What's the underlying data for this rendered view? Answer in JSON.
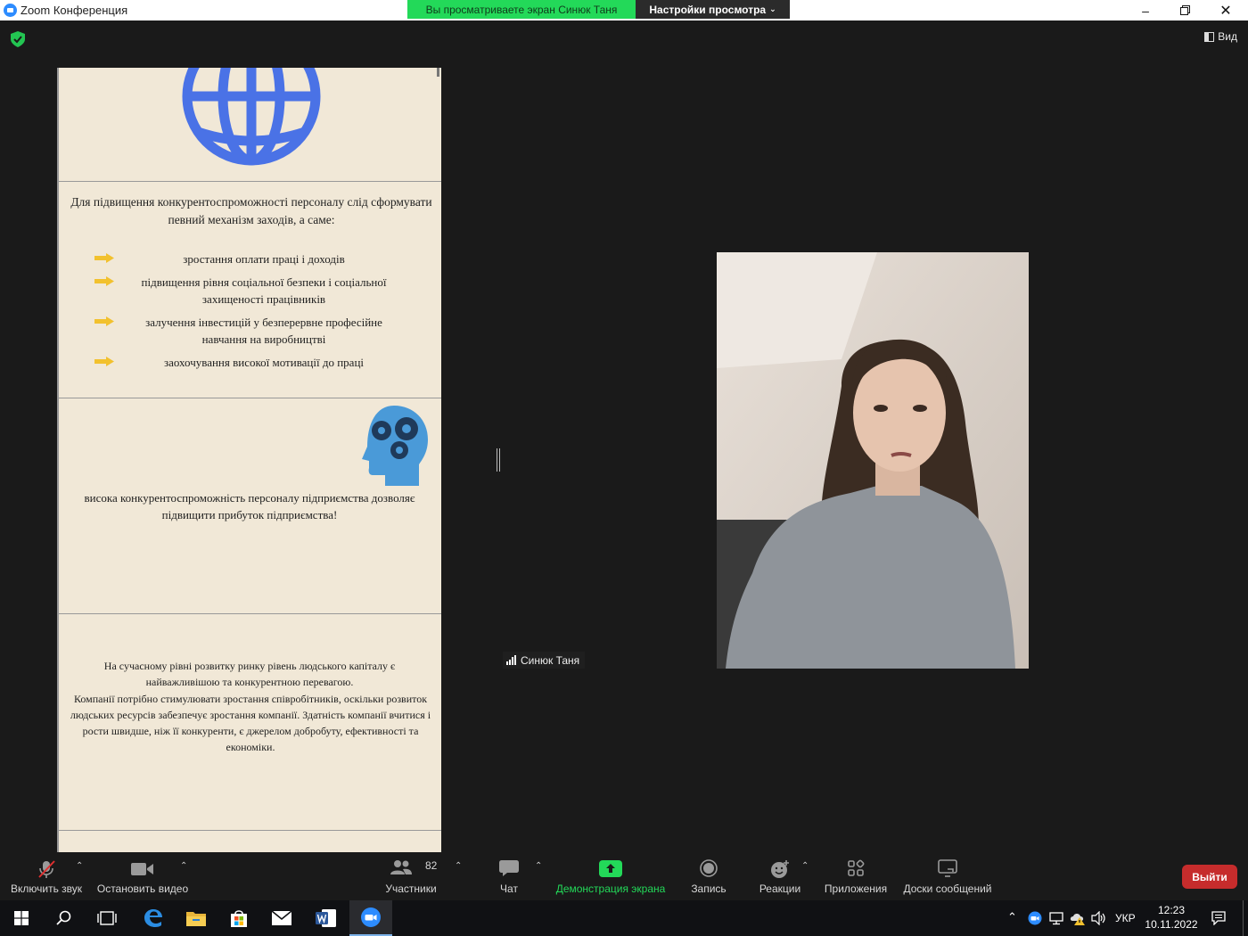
{
  "window": {
    "title": "Zoom Конференция"
  },
  "share_banner": {
    "text": "Вы просматриваете экран Синюк Таня",
    "view_settings": "Настройки просмотра"
  },
  "view_button": {
    "label": "Вид"
  },
  "document": {
    "section1": {
      "intro": "Для підвищення конкурентоспроможності персоналу слід сформувати певний механізм заходів, а саме:",
      "bullets": [
        "зростання оплати праці і доходів",
        "підвищення рівня соціальної безпеки і соціальної захищеності працівників",
        "залучення інвестицій у безперервне професійне навчання на виробництві",
        "заохочування високої мотивації до праці"
      ]
    },
    "section2": {
      "text": "висока конкурентоспроможність персоналу підприємства дозволяє підвищити прибуток підприємства!"
    },
    "section3": {
      "p1": "На сучасному рівні розвитку ринку рівень людського капіталу є найважливішою та конкурентною перевагою.",
      "p2": "Компанії потрібно стимулювати зростання співробітників, оскільки розвиток людських ресурсів забезпечує зростання компанії. Здатність компанії вчитися і рости швидше, ніж її конкуренти, є джерелом добробуту, ефективності та економіки."
    }
  },
  "participant": {
    "name": "Синюк Таня"
  },
  "toolbar": {
    "unmute": "Включить звук",
    "stop_video": "Остановить видео",
    "participants": "Участники",
    "participants_count": "82",
    "chat": "Чат",
    "share_screen": "Демонстрация экрана",
    "record": "Запись",
    "reactions": "Реакции",
    "apps": "Приложения",
    "whiteboards": "Доски сообщений",
    "leave": "Выйти"
  },
  "colors": {
    "share_green": "#23d959",
    "leave_red": "#c62c2c",
    "doc_bg": "#f1e8d7",
    "globe_blue": "#4a72e6",
    "arrow_yellow": "#f2c12e"
  },
  "taskbar": {
    "icons": [
      "windows-start-icon",
      "search-icon",
      "task-view-icon",
      "edge-icon",
      "file-explorer-icon",
      "store-icon",
      "mail-icon",
      "word-icon",
      "zoom-icon"
    ],
    "language": "УКР",
    "time": "12:23",
    "date": "10.11.2022"
  }
}
